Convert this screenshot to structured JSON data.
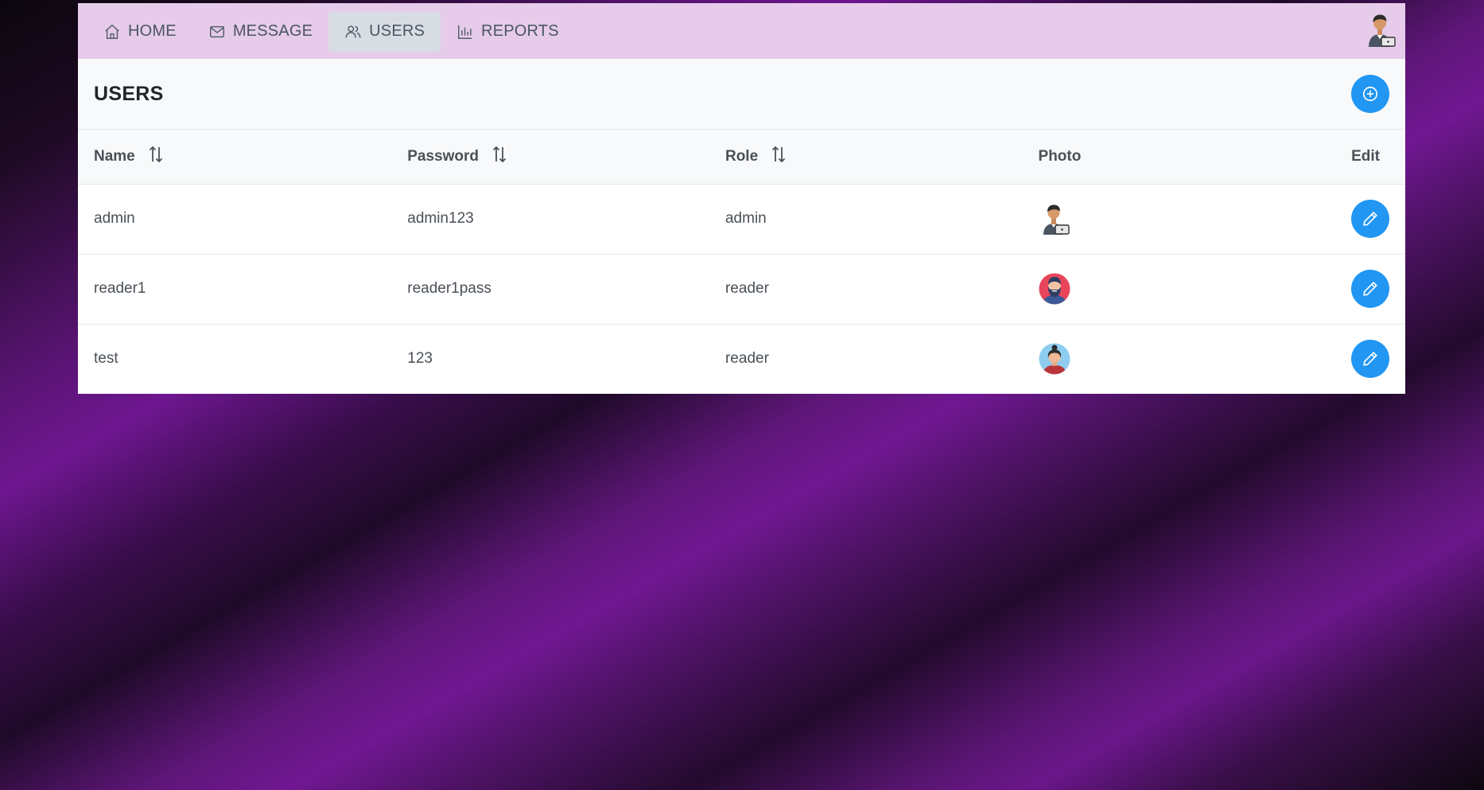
{
  "nav": {
    "items": [
      {
        "label": "HOME",
        "icon": "home-icon"
      },
      {
        "label": "MESSAGE",
        "icon": "mail-icon"
      },
      {
        "label": "USERS",
        "icon": "users-icon",
        "active": true
      },
      {
        "label": "REPORTS",
        "icon": "bar-chart-icon"
      }
    ],
    "avatar": "user-avatar"
  },
  "page": {
    "title": "USERS",
    "add_icon": "plus-circle-icon"
  },
  "table": {
    "columns": [
      "Name",
      "Password",
      "Role",
      "Photo",
      "Edit"
    ],
    "sortable": [
      true,
      true,
      true,
      false,
      false
    ],
    "rows": [
      {
        "name": "admin",
        "password": "admin123",
        "role": "admin",
        "photo": "admin-avatar"
      },
      {
        "name": "reader1",
        "password": "reader1pass",
        "role": "reader",
        "photo": "bearded-man-avatar"
      },
      {
        "name": "test",
        "password": "123",
        "role": "reader",
        "photo": "woman-avatar"
      }
    ]
  },
  "colors": {
    "navbar": "#e6cbea",
    "accent": "#2196f3",
    "active_tab": "#d8dce3"
  }
}
